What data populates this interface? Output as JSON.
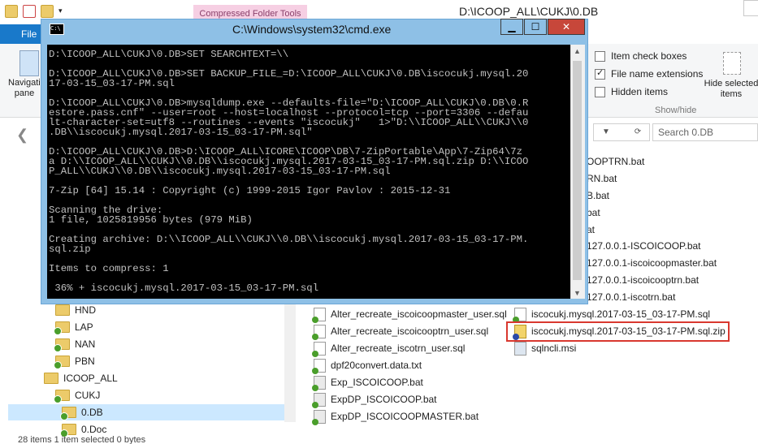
{
  "explorer": {
    "context_tab": "Compressed Folder Tools",
    "title": "D:\\ICOOP_ALL\\CUKJ\\0.DB",
    "file_tab": "File",
    "navigation_pane_label": "Navigation pane",
    "ribbon": {
      "item_check_boxes": "Item check boxes",
      "file_name_extensions": "File name extensions",
      "hidden_items": "Hidden items",
      "hide_selected_items": "Hide selected items",
      "group_label": "Show/hide",
      "file_name_extensions_checked": true
    },
    "search_placeholder": "Search 0.DB",
    "tree": [
      {
        "label": "HND",
        "icon": "folder-synced-icon"
      },
      {
        "label": "LAP",
        "icon": "folder-synced-icon"
      },
      {
        "label": "NAN",
        "icon": "folder-synced-icon"
      },
      {
        "label": "PBN",
        "icon": "folder-synced-icon"
      },
      {
        "label": "ICOOP_ALL",
        "icon": "folder-icon"
      },
      {
        "label": "CUKJ",
        "icon": "folder-synced-icon"
      },
      {
        "label": "0.DB",
        "icon": "folder-synced-icon",
        "selected": true
      },
      {
        "label": "0.Doc",
        "icon": "folder-synced-icon"
      }
    ],
    "files_col1": [
      "Alter_recreate_iscoicoopmaster_user.sql",
      "Alter_recreate_iscoicooptrn_user.sql",
      "Alter_recreate_iscotrn_user.sql",
      "dpf20convert.data.txt",
      "Exp_ISCOICOOP.bat",
      "ExpDP_ISCOICOOP.bat",
      "ExpDP_ISCOICOOPMASTER.bat"
    ],
    "files_col2_partial": [
      "OOPTRN.bat",
      "RN.bat",
      "B.bat",
      "bat",
      "at",
      "127.0.0.1-ISCOICOOP.bat",
      "127.0.0.1-iscoicoopmaster.bat",
      "127.0.0.1-iscoicooptrn.bat",
      "127.0.0.1-iscotrn.bat"
    ],
    "files_col2": [
      "iscocukj.mysql.2017-03-15_03-17-PM.sql",
      "iscocukj.mysql.2017-03-15_03-17-PM.sql.zip",
      "sqlncli.msi"
    ],
    "status": "28 items    1 item selected  0 bytes"
  },
  "cmd": {
    "title": "C:\\Windows\\system32\\cmd.exe",
    "lines": [
      "D:\\ICOOP_ALL\\CUKJ\\0.DB>SET SEARCHTEXT=\\\\",
      "",
      "D:\\ICOOP_ALL\\CUKJ\\0.DB>SET BACKUP_FILE_=D:\\ICOOP_ALL\\CUKJ\\0.DB\\iscocukj.mysql.20",
      "17-03-15_03-17-PM.sql",
      "",
      "D:\\ICOOP_ALL\\CUKJ\\0.DB>mysqldump.exe --defaults-file=\"D:\\ICOOP_ALL\\CUKJ\\0.DB\\0.R",
      "estore.pass.cnf\" --user=root --host=localhost --protocol=tcp --port=3306 --defau",
      "lt-character-set=utf8 --routines --events \"iscocukj\"   1>\"D:\\\\ICOOP_ALL\\\\CUKJ\\\\0",
      ".DB\\\\iscocukj.mysql.2017-03-15_03-17-PM.sql\"",
      "",
      "D:\\ICOOP_ALL\\CUKJ\\0.DB>D:\\ICOOP_ALL\\ICORE\\ICOOP\\DB\\7-ZipPortable\\App\\7-Zip64\\7z",
      "a D:\\\\ICOOP_ALL\\\\CUKJ\\\\0.DB\\\\iscocukj.mysql.2017-03-15_03-17-PM.sql.zip D:\\\\ICOO",
      "P_ALL\\\\CUKJ\\\\0.DB\\\\iscocukj.mysql.2017-03-15_03-17-PM.sql",
      "",
      "7-Zip [64] 15.14 : Copyright (c) 1999-2015 Igor Pavlov : 2015-12-31",
      "",
      "Scanning the drive:",
      "1 file, 1025819956 bytes (979 MiB)",
      "",
      "Creating archive: D:\\\\ICOOP_ALL\\\\CUKJ\\\\0.DB\\\\iscocukj.mysql.2017-03-15_03-17-PM.",
      "sql.zip",
      "",
      "Items to compress: 1",
      "",
      " 36% + iscocukj.mysql.2017-03-15_03-17-PM.sql"
    ],
    "minimize": "▁",
    "maximize": "☐",
    "close": "✕"
  }
}
